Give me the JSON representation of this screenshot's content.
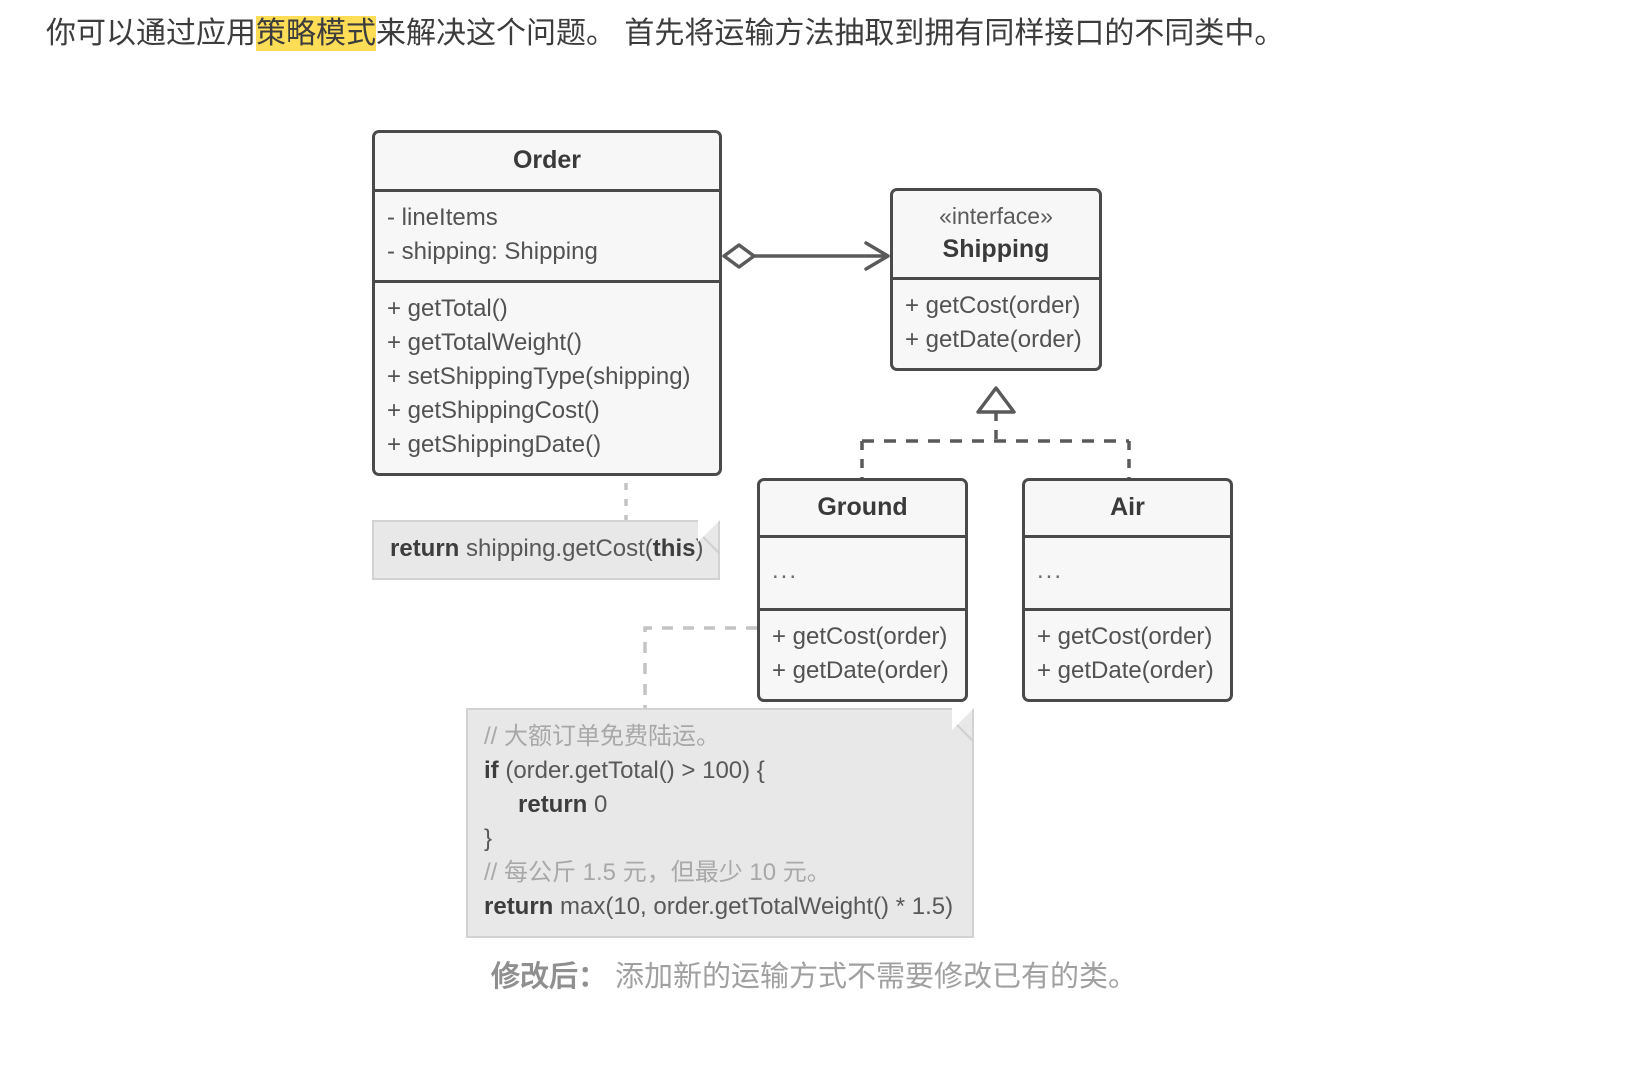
{
  "intro": {
    "before": "你可以通过应用",
    "highlight": "策略模式",
    "after": "来解决这个问题。 首先将运输方法抽取到拥有同样接口的不同类中。"
  },
  "diagram": {
    "type": "uml-class-diagram",
    "classes": [
      {
        "id": "order",
        "name": "Order",
        "stereotype": "",
        "fields": [
          "- lineItems",
          "- shipping: Shipping"
        ],
        "methods": [
          "+ getTotal()",
          "+ getTotalWeight()",
          "+ setShippingType(shipping)",
          "+ getShippingCost()",
          "+ getShippingDate()"
        ]
      },
      {
        "id": "shipping",
        "name": "Shipping",
        "stereotype": "«interface»",
        "fields": [],
        "methods": [
          "+ getCost(order)",
          "+ getDate(order)"
        ]
      },
      {
        "id": "ground",
        "name": "Ground",
        "stereotype": "",
        "fields": [
          "..."
        ],
        "methods": [
          "+ getCost(order)",
          "+ getDate(order)"
        ]
      },
      {
        "id": "air",
        "name": "Air",
        "stereotype": "",
        "fields": [
          "..."
        ],
        "methods": [
          "+ getCost(order)",
          "+ getDate(order)"
        ]
      }
    ],
    "relations": [
      {
        "from": "order",
        "to": "shipping",
        "kind": "aggregation-directed"
      },
      {
        "from": "ground",
        "to": "shipping",
        "kind": "realization"
      },
      {
        "from": "air",
        "to": "shipping",
        "kind": "realization"
      }
    ]
  },
  "notes": {
    "order_cost": {
      "anchor_method": "+ getShippingCost()",
      "lines": [
        {
          "bold": "return",
          "rest": " shipping.getCost(",
          "bold2": "this",
          "rest2": ")"
        }
      ],
      "text": "return shipping.getCost(this)"
    },
    "ground_cost": {
      "anchor_method": "+ getCost(order)",
      "lines": [
        {
          "kind": "comment",
          "text": "// 大额订单免费陆运。"
        },
        {
          "kind": "code",
          "bold": "if",
          "text": " (order.getTotal() > 100) {"
        },
        {
          "kind": "code-indent",
          "bold": "return",
          "text": " 0"
        },
        {
          "kind": "code",
          "bold": "",
          "text": "}"
        },
        {
          "kind": "comment",
          "text": "// 每公斤 1.5 元，但最少 10 元。"
        },
        {
          "kind": "code",
          "bold": "return",
          "text": " max(10, order.getTotalWeight() * 1.5)"
        }
      ]
    }
  },
  "caption": {
    "strong": "修改后：",
    "rest": " 添加新的运输方式不需要修改已有的类。"
  },
  "colors": {
    "highlight": "#ffdd57",
    "box_border": "#4a4a4a",
    "box_fill": "#f7f7f7",
    "note_fill": "#e8e8e8",
    "note_border": "#d2d2d2",
    "connector": "#5a5a5a",
    "dashed_connector": "#c4c4c4",
    "caption_text": "#a0a0a0"
  }
}
